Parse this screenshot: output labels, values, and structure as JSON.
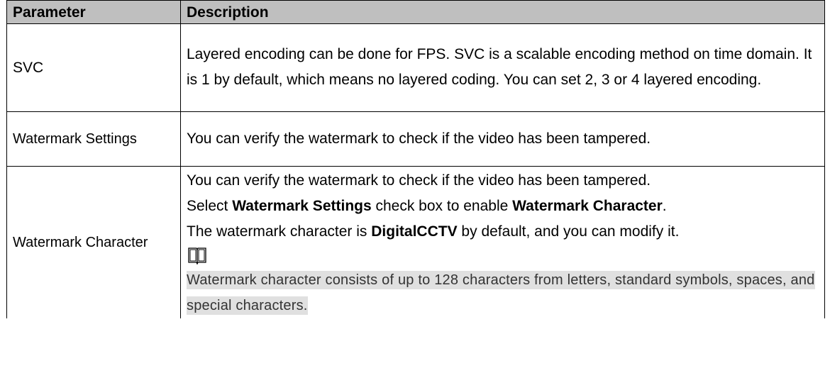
{
  "table": {
    "header": {
      "parameter": "Parameter",
      "description": "Description"
    },
    "rows": [
      {
        "parameter": "SVC",
        "description": "Layered encoding can be done for FPS. SVC is a scalable encoding method on time domain. It is 1 by default, which means no layered coding. You can set 2, 3 or 4 layered encoding."
      },
      {
        "parameter": "Watermark Settings",
        "description": "You can verify the watermark to check if the video has been tampered."
      },
      {
        "parameter": "Watermark Character",
        "description_intro": "You can verify the watermark to check if the video has been tampered.",
        "select_prefix": "Select ",
        "select_bold_1": "Watermark Settings",
        "select_middle": " check box to enable ",
        "select_bold_2": "Watermark Character",
        "select_suffix": ".",
        "default_prefix": "The watermark character is ",
        "default_bold": "DigitalCCTV",
        "default_suffix": " by default, and you can modify it.",
        "note_icon": "book-icon",
        "note": "Watermark character consists of up to 128 characters from letters, standard symbols, spaces, and special characters."
      }
    ]
  },
  "colors": {
    "header_bg": "#bfbfbf",
    "note_bg": "#e0e0e0",
    "border": "#000000"
  }
}
